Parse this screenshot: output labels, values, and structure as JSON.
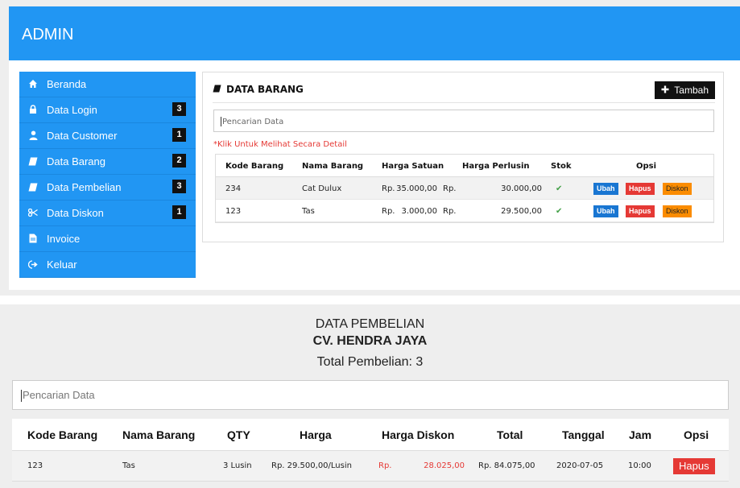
{
  "header": {
    "title": "ADMIN"
  },
  "sidebar": {
    "items": [
      {
        "label": "Beranda",
        "icon": "home-icon",
        "badge": ""
      },
      {
        "label": "Data Login",
        "icon": "lock-icon",
        "badge": "3"
      },
      {
        "label": "Data Customer",
        "icon": "user-icon",
        "badge": "1"
      },
      {
        "label": "Data Barang",
        "icon": "book-icon",
        "badge": "2"
      },
      {
        "label": "Data Pembelian",
        "icon": "book-icon",
        "badge": "3"
      },
      {
        "label": "Data Diskon",
        "icon": "scissors-icon",
        "badge": "1"
      },
      {
        "label": "Invoice",
        "icon": "file-icon",
        "badge": ""
      },
      {
        "label": "Keluar",
        "icon": "logout-icon",
        "badge": ""
      }
    ]
  },
  "barang": {
    "title": "DATA BARANG",
    "add_label": "Tambah",
    "search_placeholder": "Pencarian Data",
    "hint": "*Klik Untuk Melihat Secara Detail",
    "columns": [
      "Kode Barang",
      "Nama Barang",
      "Harga Satuan",
      "Harga Perlusin",
      "Stok",
      "Opsi"
    ],
    "rows": [
      {
        "kode": "234",
        "nama": "Cat Dulux",
        "rp1": "Rp.",
        "satuan": "35.000,00",
        "rp2": "Rp.",
        "perlusin": "30.000,00",
        "stok": "✔"
      },
      {
        "kode": "123",
        "nama": "Tas",
        "rp1": "Rp.",
        "satuan": "3.000,00",
        "rp2": "Rp.",
        "perlusin": "29.500,00",
        "stok": "✔"
      }
    ],
    "actions": {
      "edit": "Ubah",
      "delete": "Hapus",
      "discount": "Diskon"
    }
  },
  "pembelian": {
    "title": "DATA PEMBELIAN",
    "company": "CV. HENDRA JAYA",
    "total_label": "Total Pembelian: 3",
    "search_placeholder": "Pencarian Data",
    "columns": [
      "Kode Barang",
      "Nama Barang",
      "QTY",
      "Harga",
      "Harga Diskon",
      "Total",
      "Tanggal",
      "Jam",
      "Opsi"
    ],
    "rows": [
      {
        "kode": "123",
        "nama": "Tas",
        "qty": "3 Lusin",
        "harga": "Rp. 29.500,00/Lusin",
        "rp": "Rp.",
        "diskon": "28.025,00",
        "total": "Rp. 84.075,00",
        "tanggal": "2020-07-05",
        "jam": "10:00",
        "action": "Hapus"
      }
    ]
  },
  "colors": {
    "primary": "#2196f3",
    "danger": "#e53935",
    "warning": "#fb8c00",
    "info": "#1976d2"
  }
}
